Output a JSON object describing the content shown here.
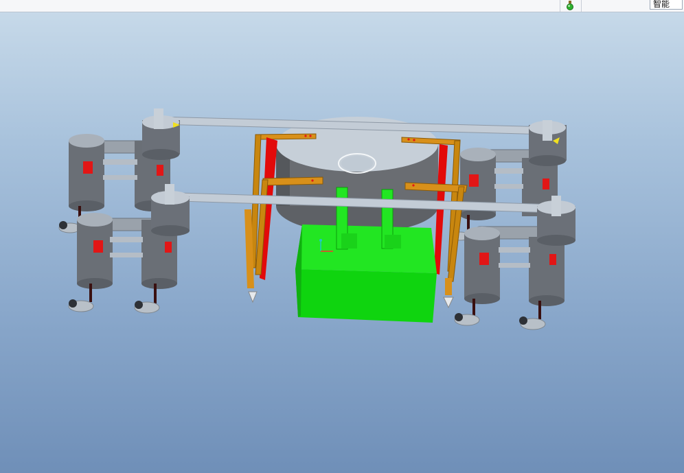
{
  "toolbar": {
    "status_icon": "green-light-icon",
    "filter_value": "智能"
  },
  "viewport": {
    "model_color_part": "#00ff00",
    "model_color_frame": "#c8860f",
    "model_color_rail": "#e00000"
  }
}
